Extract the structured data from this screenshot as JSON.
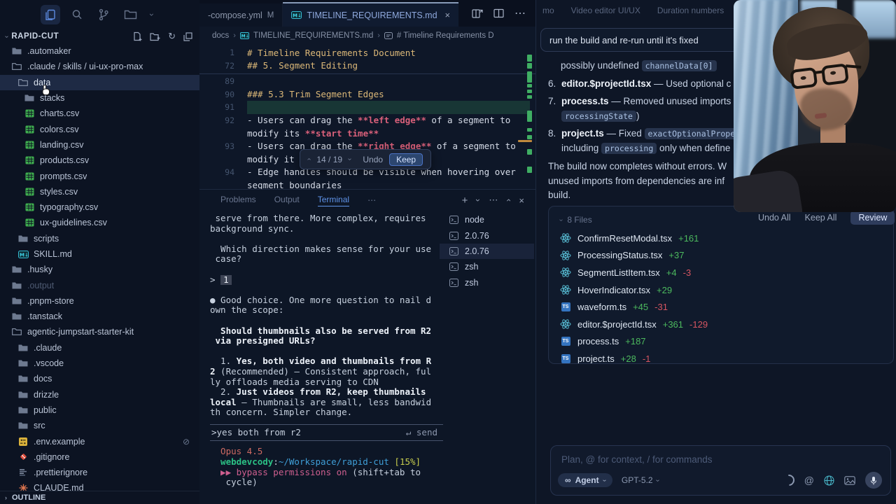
{
  "activity_bar": {
    "icons": [
      "files",
      "search",
      "source-control",
      "explorer-folder",
      "chevron-down"
    ]
  },
  "sidebar": {
    "project": "RAPID-CUT",
    "actions": [
      "new-file",
      "new-folder",
      "refresh",
      "collapse-all"
    ],
    "outline_label": "OUTLINE",
    "tree": [
      {
        "name": ".automaker",
        "icon": "folder",
        "ind": 0
      },
      {
        "name": ".claude / skills / ui-ux-pro-max",
        "icon": "folder-o",
        "ind": 0
      },
      {
        "name": "data",
        "icon": "folder-o",
        "ind": 1,
        "selected": true
      },
      {
        "name": "stacks",
        "icon": "folder",
        "ind": 2
      },
      {
        "name": "charts.csv",
        "icon": "csv",
        "ind": 2
      },
      {
        "name": "colors.csv",
        "icon": "csv",
        "ind": 2
      },
      {
        "name": "landing.csv",
        "icon": "csv",
        "ind": 2
      },
      {
        "name": "products.csv",
        "icon": "csv",
        "ind": 2
      },
      {
        "name": "prompts.csv",
        "icon": "csv",
        "ind": 2
      },
      {
        "name": "styles.csv",
        "icon": "csv",
        "ind": 2
      },
      {
        "name": "typography.csv",
        "icon": "csv",
        "ind": 2
      },
      {
        "name": "ux-guidelines.csv",
        "icon": "csv",
        "ind": 2
      },
      {
        "name": "scripts",
        "icon": "folder",
        "ind": 1
      },
      {
        "name": "SKILL.md",
        "icon": "md",
        "ind": 1
      },
      {
        "name": ".husky",
        "icon": "folder",
        "ind": 0
      },
      {
        "name": ".output",
        "icon": "folder",
        "ind": 0,
        "dim": true
      },
      {
        "name": ".pnpm-store",
        "icon": "folder",
        "ind": 0
      },
      {
        "name": ".tanstack",
        "icon": "folder",
        "ind": 0
      },
      {
        "name": "agentic-jumpstart-starter-kit",
        "icon": "folder-o",
        "ind": 0
      },
      {
        "name": ".claude",
        "icon": "folder",
        "ind": 1
      },
      {
        "name": ".vscode",
        "icon": "folder",
        "ind": 1
      },
      {
        "name": "docs",
        "icon": "folder",
        "ind": 1
      },
      {
        "name": "drizzle",
        "icon": "folder",
        "ind": 1
      },
      {
        "name": "public",
        "icon": "folder",
        "ind": 1
      },
      {
        "name": "src",
        "icon": "folder",
        "ind": 1
      },
      {
        "name": ".env.example",
        "icon": "env",
        "ind": 1,
        "badge": "⊘"
      },
      {
        "name": ".gitignore",
        "icon": "git",
        "ind": 1
      },
      {
        "name": ".prettierignore",
        "icon": "prettier",
        "ind": 1
      },
      {
        "name": "CLAUDE.md",
        "icon": "claude",
        "ind": 1
      }
    ]
  },
  "editor": {
    "tabs": [
      {
        "label": "-compose.yml",
        "modified": "M"
      },
      {
        "label": "TIMELINE_REQUIREMENTS.md",
        "close": "×"
      }
    ],
    "breadcrumb": [
      "docs",
      "TIMELINE_REQUIREMENTS.md",
      "# Timeline Requirements D"
    ],
    "lines": [
      {
        "num": "1",
        "sticky": true,
        "segments": [
          {
            "t": "# Timeline Requirements Document",
            "c": "heading"
          }
        ]
      },
      {
        "num": "72",
        "sticky": true,
        "segments": [
          {
            "t": "## 5. Segment Editing",
            "c": "heading"
          }
        ]
      },
      {
        "num": "89",
        "segments": []
      },
      {
        "num": "90",
        "segments": [
          {
            "t": "### 5.3 Trim Segment Edges",
            "c": "heading"
          }
        ]
      },
      {
        "num": "91",
        "highlight": true,
        "segments": []
      },
      {
        "num": "92",
        "segments": [
          {
            "t": "- Users can drag the ",
            "c": "plain"
          },
          {
            "t": "**left edge**",
            "c": "bold"
          },
          {
            "t": " of a segment to",
            "c": "plain"
          }
        ]
      },
      {
        "num": "",
        "segments": [
          {
            "t": "modify its ",
            "c": "plain"
          },
          {
            "t": "**start time**",
            "c": "bold"
          }
        ]
      },
      {
        "num": "93",
        "segments": [
          {
            "t": "- Users can drag the ",
            "c": "plain"
          },
          {
            "t": "**right edge**",
            "c": "bold"
          },
          {
            "t": " of a segment to",
            "c": "plain"
          }
        ]
      },
      {
        "num": "",
        "segments": [
          {
            "t": "modify it",
            "c": "plain"
          }
        ]
      },
      {
        "num": "94",
        "segments": [
          {
            "t": "- Edge handles should be visible when hovering over",
            "c": "plain"
          }
        ]
      },
      {
        "num": "",
        "segments": [
          {
            "t": "segment boundaries",
            "c": "plain"
          }
        ]
      }
    ],
    "review_widget": {
      "up": "›",
      "counter": "14 / 19",
      "down": "›",
      "undo": "Undo",
      "keep": "Keep"
    }
  },
  "panel": {
    "tabs": [
      "Problems",
      "Output",
      "Terminal"
    ],
    "active_tab": "Terminal",
    "more": "⋯",
    "actions": [
      "new-terminal",
      "terminal-picker",
      "more",
      "maximize",
      "close"
    ],
    "lines": [
      [
        {
          "t": " serve from there. More complex, requires",
          "c": "plain"
        }
      ],
      [
        {
          "t": "background sync.",
          "c": "plain"
        }
      ],
      [],
      [
        {
          "t": "  Which direction makes sense for your use",
          "c": "plain"
        }
      ],
      [
        {
          "t": " case?",
          "c": "plain"
        }
      ],
      [],
      [
        {
          "t": "> ",
          "c": "plain"
        },
        {
          "t": "1",
          "c": "chip"
        }
      ],
      [],
      [
        {
          "t": "● Good choice. One more question to nail d",
          "c": "plain"
        }
      ],
      [
        {
          "t": "own the scope:",
          "c": "plain"
        }
      ],
      [],
      [
        {
          "t": "  Should thumbnails also be served from R2",
          "c": "bold"
        }
      ],
      [
        {
          "t": " via presigned URLs?",
          "c": "bold"
        }
      ],
      [],
      [
        {
          "t": "  1. ",
          "c": "plain"
        },
        {
          "t": "Yes, both video and thumbnails from R",
          "c": "bold"
        }
      ],
      [
        {
          "t": "2",
          "c": "bold"
        },
        {
          "t": " (Recommended) — Consistent approach, ful",
          "c": "plain"
        }
      ],
      [
        {
          "t": "ly offloads media serving to CDN",
          "c": "plain"
        }
      ],
      [
        {
          "t": "  2. ",
          "c": "plain"
        },
        {
          "t": "Just videos from R2, keep thumbnails",
          "c": "bold"
        }
      ],
      [
        {
          "t": "local",
          "c": "bold"
        },
        {
          "t": " — Thumbnails are small, less bandwid",
          "c": "plain"
        }
      ],
      [
        {
          "t": "th concern. Simpler change.",
          "c": "plain"
        }
      ]
    ],
    "input_line": {
      "prompt": "> ",
      "value": "yes both from r2",
      "send": "↵ send"
    },
    "status_lines": [
      [
        {
          "t": "  Opus 4.5",
          "c": "red"
        }
      ],
      [
        {
          "t": "  webdevcody",
          "c": "green"
        },
        {
          "t": ":",
          "c": "plain"
        },
        {
          "t": "~/Workspace/rapid-cut",
          "c": "blue"
        },
        {
          "t": " ",
          "c": "plain"
        },
        {
          "t": "[15%]",
          "c": "yellow"
        }
      ],
      [
        {
          "t": "  ▶▶ bypass permissions on ",
          "c": "pink"
        },
        {
          "t": "(shift+tab to",
          "c": "plain"
        }
      ],
      [
        {
          "t": "   cycle)",
          "c": "plain"
        }
      ]
    ],
    "sessions": [
      {
        "name": "node"
      },
      {
        "name": "2.0.76"
      },
      {
        "name": "2.0.76",
        "selected": true
      },
      {
        "name": "zsh"
      },
      {
        "name": "zsh"
      }
    ]
  },
  "chat": {
    "tabs": [
      "mo",
      "Video editor UI/UX",
      "Duration numbers"
    ],
    "user_message": "run the build and re-run until it's fixed",
    "body": [
      {
        "type": "line",
        "segments": [
          {
            "t": "possibly undefined ",
            "c": "plain"
          },
          {
            "t": "channelData[0]",
            "c": "chip"
          }
        ]
      },
      {
        "type": "item",
        "num": "6.",
        "lines": [
          [
            {
              "t": "editor.$projectId.tsx",
              "c": "bold"
            },
            {
              "t": " — Used optional c",
              "c": "plain"
            }
          ]
        ]
      },
      {
        "type": "item",
        "num": "7.",
        "lines": [
          [
            {
              "t": "process.ts",
              "c": "bold"
            },
            {
              "t": " — Removed unused imports",
              "c": "plain"
            }
          ],
          [
            {
              "t": "rocessingState",
              "c": "chip"
            },
            {
              "t": ")",
              "c": "plain"
            }
          ]
        ]
      },
      {
        "type": "item",
        "num": "8.",
        "lines": [
          [
            {
              "t": "project.ts",
              "c": "bold"
            },
            {
              "t": " — Fixed ",
              "c": "plain"
            },
            {
              "t": "exactOptionalPrope",
              "c": "chip"
            }
          ],
          [
            {
              "t": "including ",
              "c": "plain"
            },
            {
              "t": "processing",
              "c": "chip"
            },
            {
              "t": " only when define",
              "c": "plain"
            }
          ]
        ]
      },
      {
        "type": "para",
        "lines": [
          [
            {
              "t": "The build now completes without errors. W",
              "c": "plain"
            }
          ],
          [
            {
              "t": "unused imports from dependencies are inf",
              "c": "plain"
            }
          ],
          [
            {
              "t": "build.",
              "c": "plain"
            }
          ]
        ]
      }
    ],
    "files": {
      "header": "8 Files",
      "items": [
        {
          "icon": "react",
          "name": "ConfirmResetModal.tsx",
          "add": "+161"
        },
        {
          "icon": "react",
          "name": "ProcessingStatus.tsx",
          "add": "+37"
        },
        {
          "icon": "react",
          "name": "SegmentListItem.tsx",
          "add": "+4",
          "del": "-3"
        },
        {
          "icon": "react",
          "name": "HoverIndicator.tsx",
          "add": "+29"
        },
        {
          "icon": "ts",
          "name": "waveform.ts",
          "add": "+45",
          "del": "-31"
        },
        {
          "icon": "react",
          "name": "editor.$projectId.tsx",
          "add": "+361",
          "del": "-129"
        },
        {
          "icon": "ts",
          "name": "process.ts",
          "add": "+187"
        },
        {
          "icon": "ts",
          "name": "project.ts",
          "add": "+28",
          "del": "-1"
        }
      ]
    },
    "review_bar": {
      "undo_all": "Undo All",
      "keep_all": "Keep All",
      "review": "Review"
    },
    "input": {
      "placeholder": "Plan, @ for context, / for commands",
      "agent": "Agent",
      "model": "GPT-5.2"
    }
  }
}
